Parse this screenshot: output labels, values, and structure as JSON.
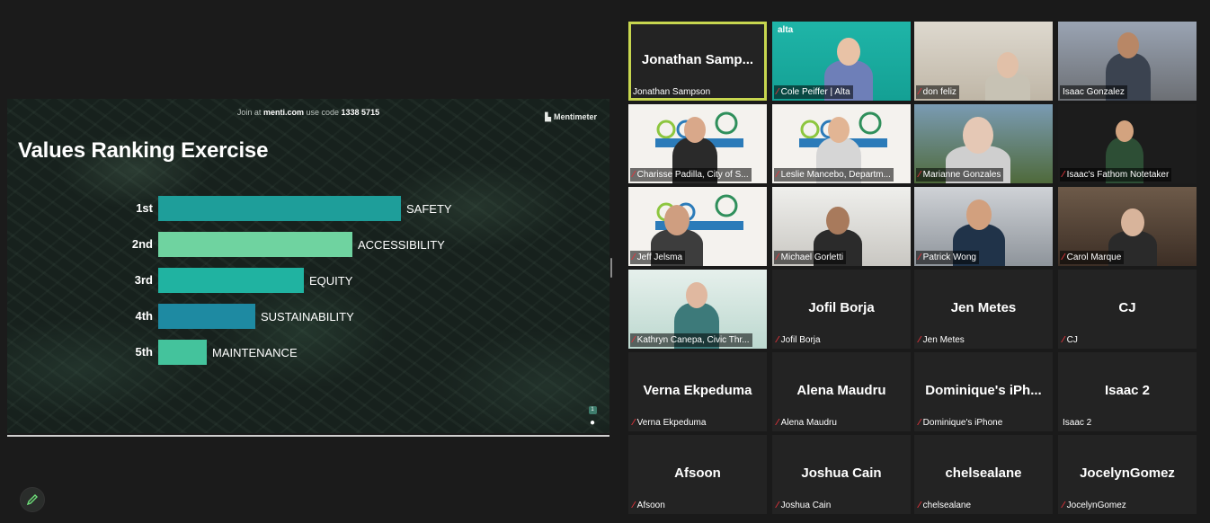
{
  "slide": {
    "join_prefix": "Join at",
    "join_site": "menti.com",
    "join_code_label": "use code",
    "join_code": "1338 5715",
    "brand": "Mentimeter",
    "title": "Values Ranking Exercise",
    "counter_badge": "1"
  },
  "chart_data": {
    "type": "bar",
    "categories": [
      "1st",
      "2nd",
      "3rd",
      "4th",
      "5th"
    ],
    "values": [
      5,
      4,
      3,
      2,
      1
    ],
    "value_labels": [
      "SAFETY",
      "ACCESSIBILITY",
      "EQUITY",
      "SUSTAINABILITY",
      "MAINTENANCE"
    ],
    "colors": [
      "#1e9e9a",
      "#6fd3a0",
      "#20b3a1",
      "#1e8aa2",
      "#44c39c"
    ],
    "xlabel": "",
    "ylabel": ""
  },
  "participants": [
    {
      "display": "Jonathan Samp...",
      "tag": "Jonathan Sampson",
      "muted": false,
      "video": false,
      "active": true
    },
    {
      "display": "",
      "tag": "Cole Peiffer | Alta",
      "muted": true,
      "video": true,
      "logo_text": "alta"
    },
    {
      "display": "",
      "tag": "don feliz",
      "muted": true,
      "video": true
    },
    {
      "display": "",
      "tag": "Isaac Gonzalez",
      "muted": false,
      "video": true
    },
    {
      "display": "",
      "tag": "Charisse Padilla, City of S...",
      "muted": true,
      "video": true
    },
    {
      "display": "",
      "tag": "Leslie Mancebo, Departm...",
      "muted": true,
      "video": true
    },
    {
      "display": "",
      "tag": "Marianne Gonzales",
      "muted": true,
      "video": true
    },
    {
      "display": "",
      "tag": "Isaac's Fathom Notetaker",
      "muted": true,
      "video": true
    },
    {
      "display": "",
      "tag": "Jeff Jelsma",
      "muted": true,
      "video": true
    },
    {
      "display": "",
      "tag": "Michael Gorletti",
      "muted": true,
      "video": true
    },
    {
      "display": "",
      "tag": "Patrick Wong",
      "muted": true,
      "video": true
    },
    {
      "display": "",
      "tag": "Carol Marque",
      "muted": true,
      "video": true
    },
    {
      "display": "",
      "tag": "Kathryn Canepa, Civic Thr...",
      "muted": true,
      "video": true
    },
    {
      "display": "Jofil Borja",
      "tag": "Jofil Borja",
      "muted": true,
      "video": false
    },
    {
      "display": "Jen Metes",
      "tag": "Jen Metes",
      "muted": true,
      "video": false
    },
    {
      "display": "CJ",
      "tag": "CJ",
      "muted": true,
      "video": false
    },
    {
      "display": "Verna Ekpeduma",
      "tag": "Verna Ekpeduma",
      "muted": true,
      "video": false
    },
    {
      "display": "Alena Maudru",
      "tag": "Alena Maudru",
      "muted": true,
      "video": false
    },
    {
      "display": "Dominique's iPh...",
      "tag": "Dominique's iPhone",
      "muted": true,
      "video": false
    },
    {
      "display": "Isaac 2",
      "tag": "Isaac 2",
      "muted": false,
      "video": false
    },
    {
      "display": "Afsoon",
      "tag": "Afsoon",
      "muted": true,
      "video": false
    },
    {
      "display": "Joshua Cain",
      "tag": "Joshua Cain",
      "muted": true,
      "video": false
    },
    {
      "display": "chelsealane",
      "tag": "chelsealane",
      "muted": true,
      "video": false
    },
    {
      "display": "JocelynGomez",
      "tag": "JocelynGomez",
      "muted": true,
      "video": false
    }
  ],
  "colors": {
    "active_speaker": "#c7d64f",
    "muted_icon": "#e5333b",
    "tile_bg": "#232323"
  }
}
